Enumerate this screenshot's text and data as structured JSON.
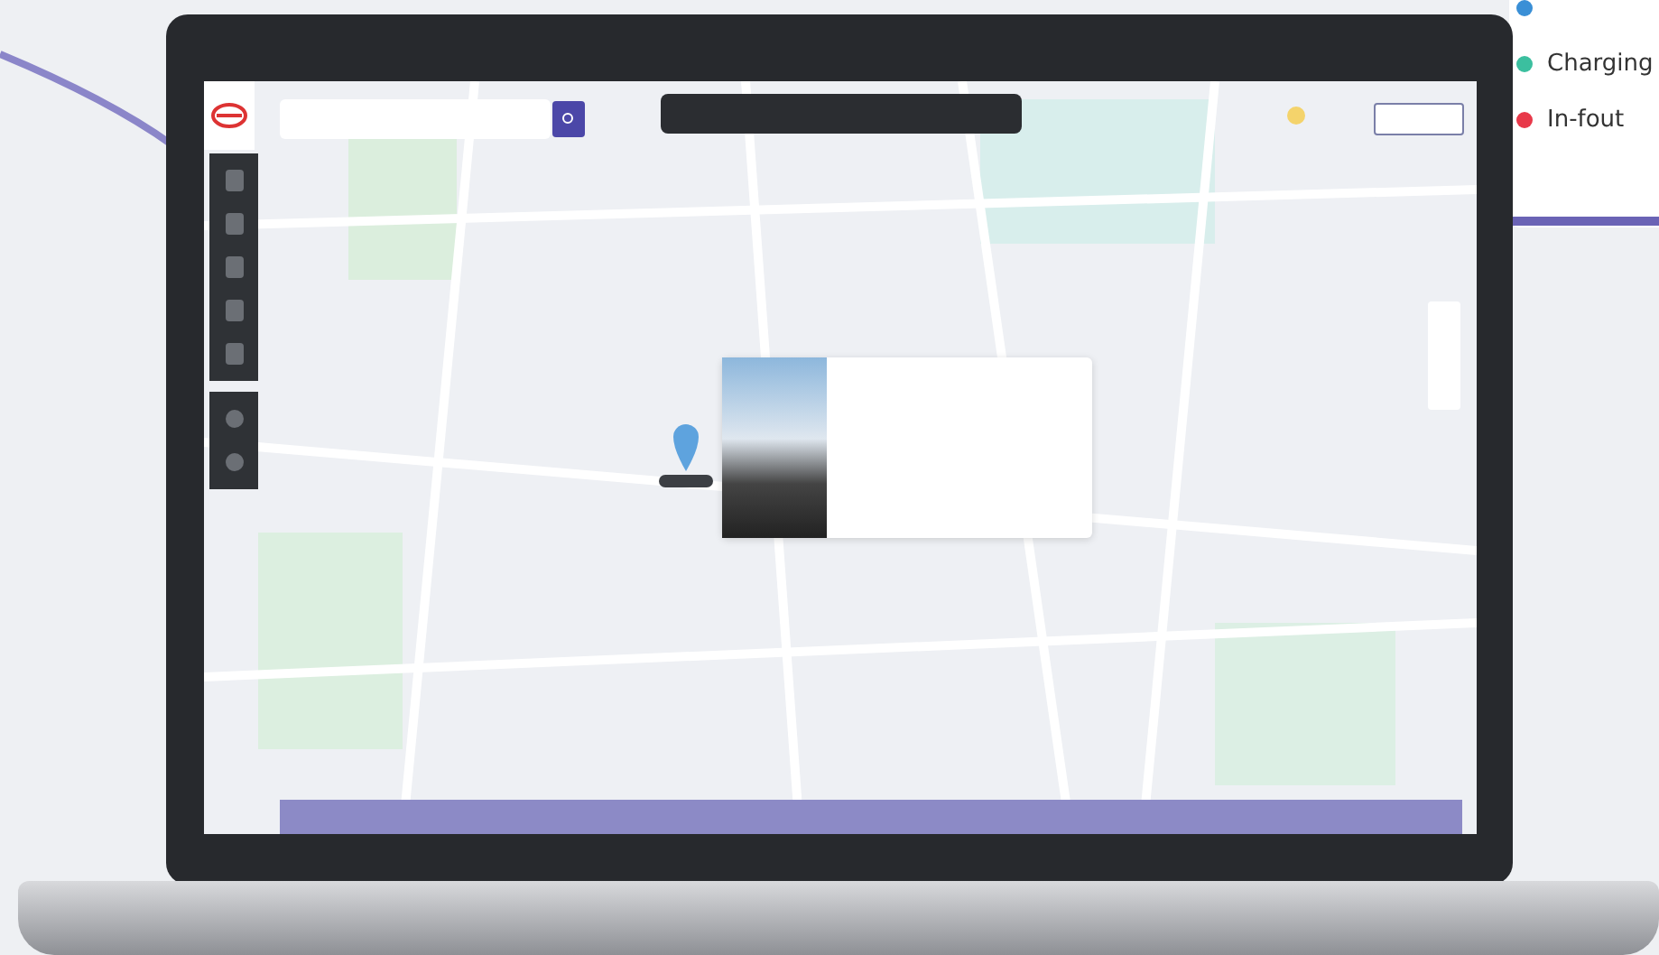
{
  "legend": [
    {
      "color": "#3a8fd6"
    },
    {
      "label": "Charging",
      "color": "#3bbf9f"
    },
    {
      "label": "In-fout",
      "color": "#e8394a"
    }
  ]
}
